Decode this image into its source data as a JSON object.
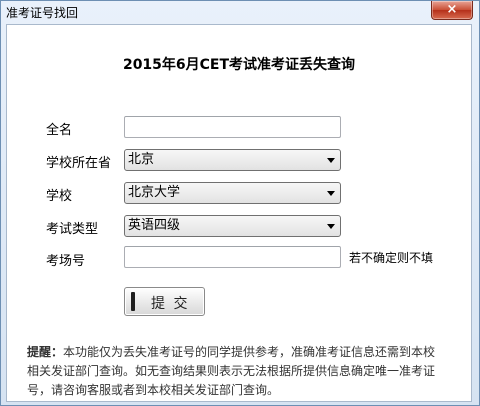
{
  "window": {
    "title": "准考证号找回",
    "close_glyph": "×"
  },
  "form": {
    "heading": "2015年6月CET考试准考证丢失查询",
    "fullname": {
      "label": "全名",
      "value": ""
    },
    "province": {
      "label": "学校所在省",
      "selected": "北京"
    },
    "school": {
      "label": "学校",
      "selected": "北京大学"
    },
    "exam_type": {
      "label": "考试类型",
      "selected": "英语四级"
    },
    "exam_room": {
      "label": "考场号",
      "value": "",
      "hint": "若不确定则不填"
    },
    "submit_label": "提 交"
  },
  "note": {
    "label": "提醒：",
    "text": "本功能仅为丢失准考证号的同学提供参考，准确准考证信息还需到本校相关发证部门查询。如无查询结果则表示无法根据所提供信息确定唯一准考证号，请咨询客服或者到本校相关发证部门查询。"
  }
}
